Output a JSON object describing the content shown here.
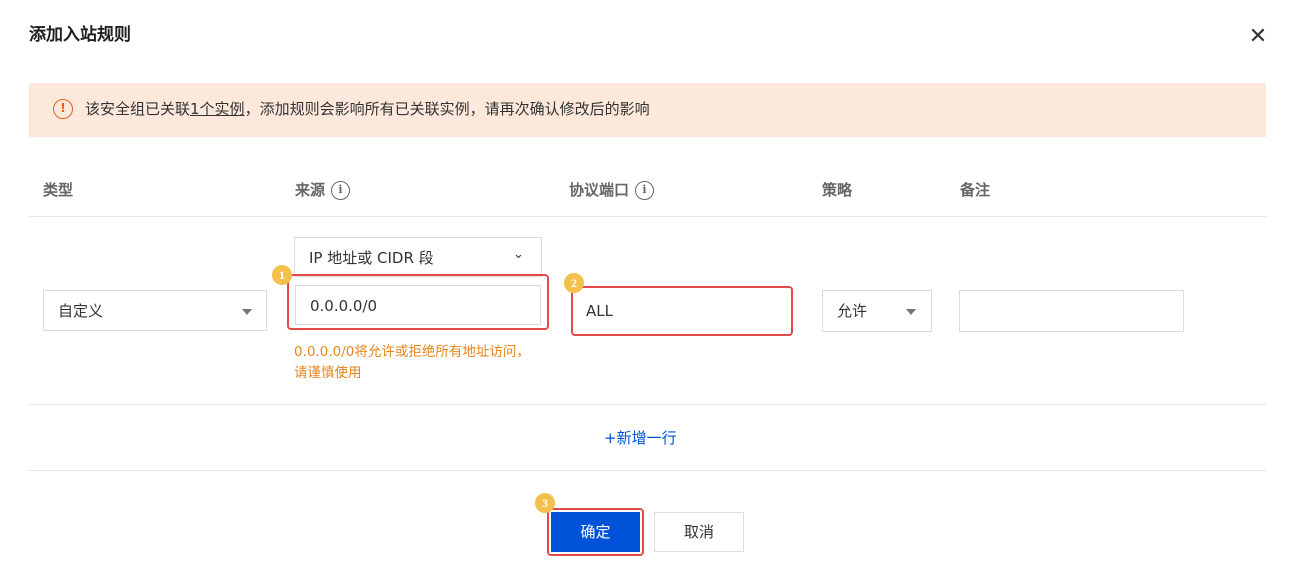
{
  "dialog": {
    "title": "添加入站规则",
    "close_icon": "close-icon"
  },
  "alert": {
    "icon": "exclamation-circle-icon",
    "icon_glyph": "!",
    "text_before": "该安全组已关联",
    "link": "1个实例",
    "text_after": "，添加规则会影响所有已关联实例，请再次确认修改后的影响",
    "color": "#e0601c",
    "background": "#fde9dc"
  },
  "table": {
    "headers": {
      "type": "类型",
      "source": "来源",
      "protocol_port": "协议端口",
      "policy": "策略",
      "remark": "备注"
    },
    "info_glyph": "i",
    "row": {
      "type_value": "自定义",
      "source_type": "IP 地址或 CIDR 段",
      "source_value": "0.0.0.0/0",
      "source_warning": "0.0.0.0/0将允许或拒绝所有地址访问，请谨慎使用",
      "protocol_port_value": "ALL",
      "policy_value": "允许",
      "remark_value": ""
    },
    "add_row_label": "+新增一行"
  },
  "annotations": {
    "badges": [
      "1",
      "2",
      "3"
    ],
    "highlight_color": "#e34b4b",
    "badge_color": "#f3c14b"
  },
  "footer": {
    "confirm_label": "确定",
    "cancel_label": "取消",
    "primary_color": "#0052d9"
  }
}
